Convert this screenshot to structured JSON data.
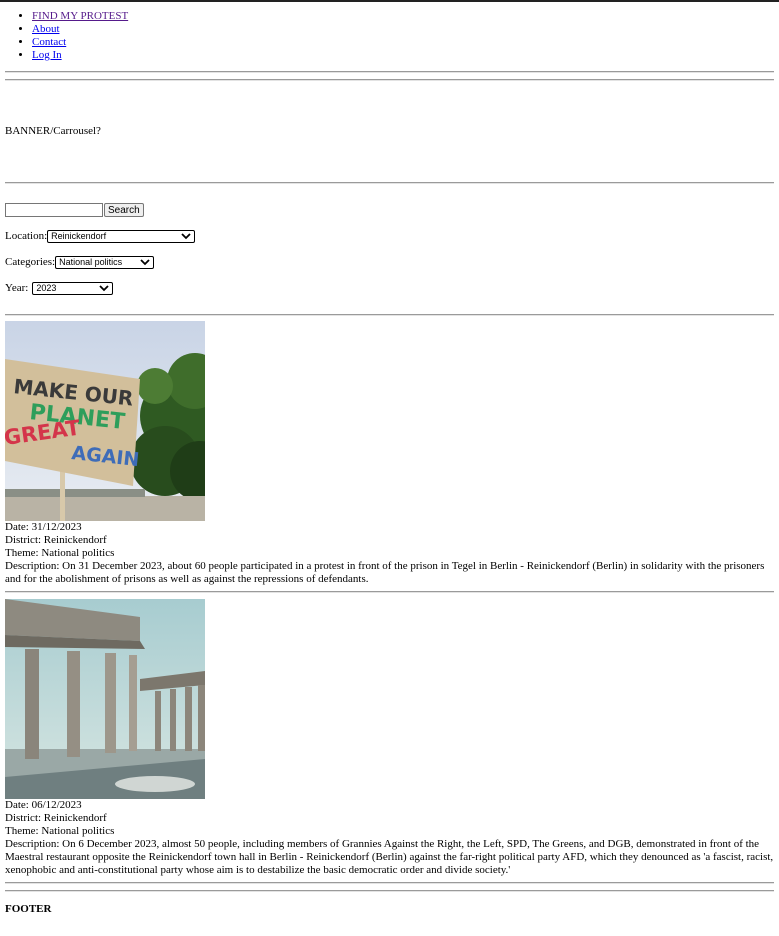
{
  "nav": {
    "items": [
      {
        "label": "FIND MY PROTEST"
      },
      {
        "label": "About"
      },
      {
        "label": "Contact"
      },
      {
        "label": "Log In"
      }
    ]
  },
  "banner": {
    "text": "BANNER/Carrousel?"
  },
  "search": {
    "placeholder": "",
    "button_label": "Search"
  },
  "filters": {
    "location": {
      "label": "Location:",
      "value": "Reinickendorf"
    },
    "categories": {
      "label": "Categories:",
      "value": "National politics"
    },
    "year": {
      "label": "Year:",
      "value": "2023"
    }
  },
  "protests": [
    {
      "image": "protest-sign-image",
      "date": "Date: 31/12/2023",
      "district": "District: Reinickendorf",
      "theme": "Theme: National politics",
      "description": "Description: On 31 December 2023, about 60 people participated in a protest in front of the prison in Tegel in Berlin - Reinickendorf (Berlin) in solidarity with the prisoners and for the abolishment of prisons as well as against the repressions of defendants."
    },
    {
      "image": "brandenburg-gate-image",
      "date": "Date: 06/12/2023",
      "district": "District: Reinickendorf",
      "theme": "Theme: National politics",
      "description": "Description: On 6 December 2023, almost 50 people, including members of Grannies Against the Right, the Left, SPD, The Greens, and DGB, demonstrated in front of the Maestral restaurant opposite the Reinickendorf town hall in Berlin - Reinickendorf (Berlin) against the far-right political party AFD, which they denounced as 'a fascist, racist, xenophobic and anti-constitutional party whose aim is to destabilize the basic democratic order and divide society.'"
    }
  ],
  "sign_text": {
    "line1": "MAKE OUR",
    "line2": "PLANET",
    "line3": "GREAT",
    "line4": "AGAIN"
  },
  "footer": {
    "text": "FOOTER"
  }
}
